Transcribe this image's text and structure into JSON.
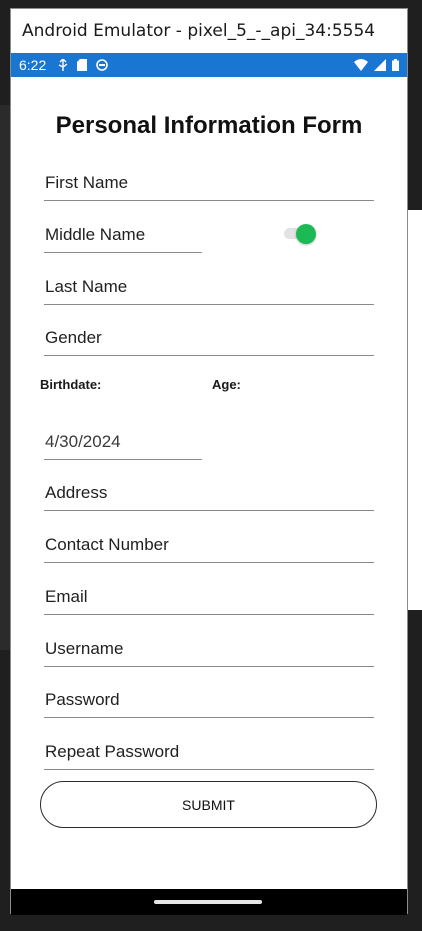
{
  "window": {
    "title": "Android Emulator - pixel_5_-_api_34:5554"
  },
  "status_bar": {
    "time": "6:22",
    "left_icons": [
      "usb-debug-icon",
      "sd-card-icon",
      "sync-icon"
    ],
    "right_icons": [
      "wifi-icon",
      "cell-signal-icon",
      "battery-icon"
    ],
    "color": "#1976d2"
  },
  "form": {
    "title": "Personal Information Form",
    "first_name": {
      "placeholder": "First Name"
    },
    "middle_name": {
      "placeholder": "Middle Name",
      "toggle_on": true
    },
    "last_name": {
      "placeholder": "Last Name"
    },
    "gender": {
      "placeholder": "Gender"
    },
    "birthdate_label": "Birthdate:",
    "age_label": "Age:",
    "birthdate_value": "4/30/2024",
    "address": {
      "placeholder": "Address"
    },
    "contact_number": {
      "placeholder": "Contact Number"
    },
    "email": {
      "placeholder": "Email"
    },
    "username": {
      "placeholder": "Username"
    },
    "password": {
      "placeholder": "Password"
    },
    "repeat_password": {
      "placeholder": "Repeat Password"
    },
    "submit_label": "SUBMIT"
  },
  "colors": {
    "toggle_accent": "#1db954",
    "background": "#ffffff"
  }
}
